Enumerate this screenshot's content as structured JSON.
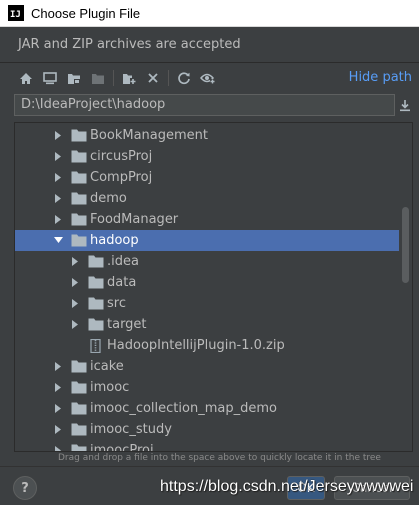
{
  "window": {
    "title": "Choose Plugin File",
    "logo_text": "IJ"
  },
  "description": "JAR and ZIP archives are accepted",
  "toolbar": {
    "icons": [
      "home-icon",
      "desktop-icon",
      "project-folder-icon",
      "module-folder-icon",
      "new-folder-icon",
      "delete-icon",
      "refresh-icon",
      "show-hidden-icon"
    ],
    "hide_path_label": "Hide path"
  },
  "path_field": {
    "value": "D:\\IdeaProject\\hadoop"
  },
  "tree": {
    "items": [
      {
        "label": "BookManagement",
        "level": 0,
        "type": "folder",
        "expanded": false,
        "selected": false
      },
      {
        "label": "circusProj",
        "level": 0,
        "type": "folder",
        "expanded": false,
        "selected": false
      },
      {
        "label": "CompProj",
        "level": 0,
        "type": "folder",
        "expanded": false,
        "selected": false
      },
      {
        "label": "demo",
        "level": 0,
        "type": "folder",
        "expanded": false,
        "selected": false
      },
      {
        "label": "FoodManager",
        "level": 0,
        "type": "folder",
        "expanded": false,
        "selected": false
      },
      {
        "label": "hadoop",
        "level": 0,
        "type": "folder",
        "expanded": true,
        "selected": true
      },
      {
        "label": ".idea",
        "level": 1,
        "type": "folder",
        "expanded": false,
        "selected": false
      },
      {
        "label": "data",
        "level": 1,
        "type": "folder",
        "expanded": false,
        "selected": false
      },
      {
        "label": "src",
        "level": 1,
        "type": "folder",
        "expanded": false,
        "selected": false
      },
      {
        "label": "target",
        "level": 1,
        "type": "folder",
        "expanded": false,
        "selected": false
      },
      {
        "label": "HadoopIntellijPlugin-1.0.zip",
        "level": 1,
        "type": "archive",
        "expanded": false,
        "selected": false
      },
      {
        "label": "icake",
        "level": 0,
        "type": "folder",
        "expanded": false,
        "selected": false
      },
      {
        "label": "imooc",
        "level": 0,
        "type": "folder",
        "expanded": false,
        "selected": false
      },
      {
        "label": "imooc_collection_map_demo",
        "level": 0,
        "type": "folder",
        "expanded": false,
        "selected": false
      },
      {
        "label": "imooc_study",
        "level": 0,
        "type": "folder",
        "expanded": false,
        "selected": false
      },
      {
        "label": "imoocProj",
        "level": 0,
        "type": "folder",
        "expanded": false,
        "selected": false
      }
    ]
  },
  "hint": "Drag and drop a file into the space above to quickly locate it in the tree",
  "buttons": {
    "help": "?",
    "ok": "OK",
    "cancel": "Cancel"
  },
  "watermark": "https://blog.csdn.net/Jerseywwwwei",
  "colors": {
    "background": "#3c3f41",
    "selection": "#4b6eaf",
    "link": "#589df6",
    "folder": "#aeb9c0",
    "archive": "#9aa7b0"
  }
}
